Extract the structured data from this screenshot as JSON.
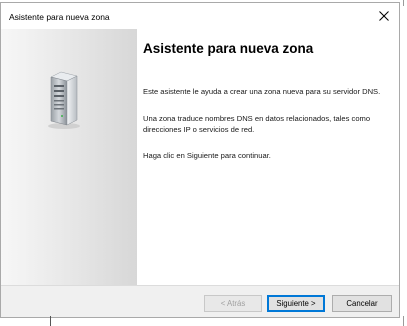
{
  "window": {
    "title": "Asistente para nueva zona",
    "close_icon": "close-icon"
  },
  "wizard": {
    "heading": "Asistente para nueva zona",
    "paragraph_1": "Este asistente le ayuda a crear una zona nueva para su servidor DNS.",
    "paragraph_2": "Una zona traduce nombres DNS en datos relacionados, tales como direcciones IP o servicios de red.",
    "paragraph_3": "Haga clic en Siguiente para continuar.",
    "illustration_icon": "server-icon"
  },
  "buttons": {
    "back": "< Atrás",
    "back_enabled": false,
    "next": "Siguiente >",
    "cancel": "Cancelar"
  },
  "colors": {
    "focus_border": "#0078d7",
    "footer_bg": "#f0f0f0"
  }
}
